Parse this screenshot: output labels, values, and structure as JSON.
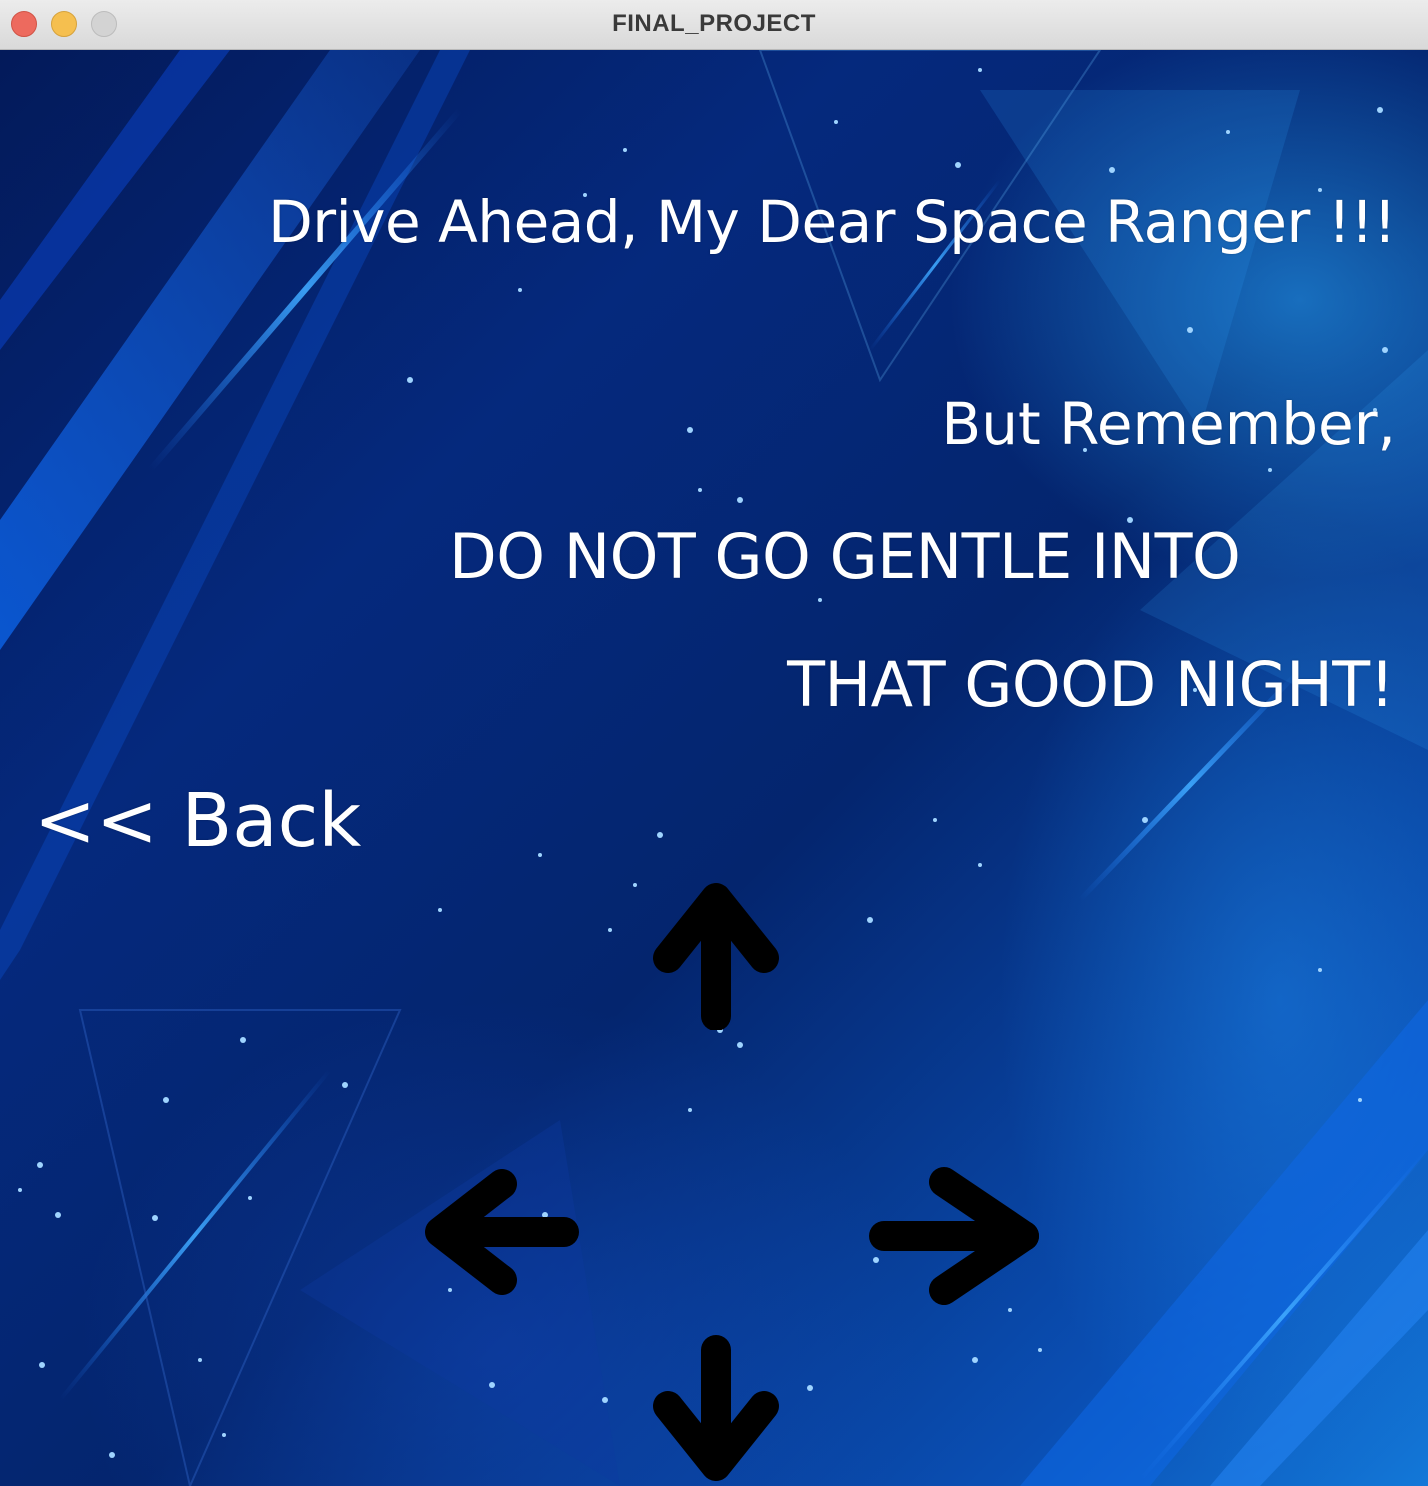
{
  "window": {
    "title": "FINAL_PROJECT",
    "controls": [
      "close",
      "minimize",
      "zoom"
    ]
  },
  "screen": {
    "headline": "Drive Ahead, My Dear Space Ranger !!!",
    "remember": "But Remember,",
    "quote_line_1": "DO NOT GO GENTLE INTO",
    "quote_line_2": "THAT GOOD NIGHT!",
    "back_label": "<< Back"
  },
  "controls": {
    "arrows": [
      "up-arrow",
      "left-arrow",
      "right-arrow",
      "down-arrow"
    ],
    "arrow_color": "#000000"
  },
  "colors": {
    "text": "#ffffff",
    "background_dark": "#031a5a",
    "background_light": "#1378d8"
  }
}
